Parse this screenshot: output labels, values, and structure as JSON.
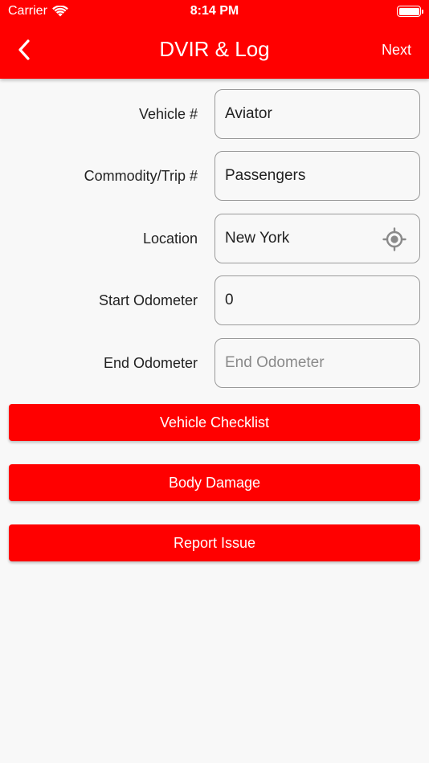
{
  "status_bar": {
    "carrier": "Carrier",
    "time": "8:14 PM",
    "wifi_icon": "wifi-icon",
    "battery_icon": "battery-icon"
  },
  "nav": {
    "title": "DVIR & Log",
    "back_icon": "chevron-left-icon",
    "next_label": "Next"
  },
  "form": {
    "vehicle": {
      "label": "Vehicle #",
      "value": "Aviator",
      "placeholder": ""
    },
    "commodity": {
      "label": "Commodity/Trip #",
      "value": "Passengers",
      "placeholder": ""
    },
    "location": {
      "label": "Location",
      "value": "New York",
      "placeholder": "",
      "icon": "locate-icon"
    },
    "start_odometer": {
      "label": "Start Odometer",
      "value": "0",
      "placeholder": ""
    },
    "end_odometer": {
      "label": "End Odometer",
      "value": "",
      "placeholder": "End Odometer"
    }
  },
  "actions": {
    "vehicle_checklist": "Vehicle Checklist",
    "body_damage": "Body Damage",
    "report_issue": "Report Issue"
  },
  "colors": {
    "accent": "#ff0000",
    "background": "#f8f8f8",
    "text": "#222222",
    "field_border": "#9a9a9a"
  }
}
